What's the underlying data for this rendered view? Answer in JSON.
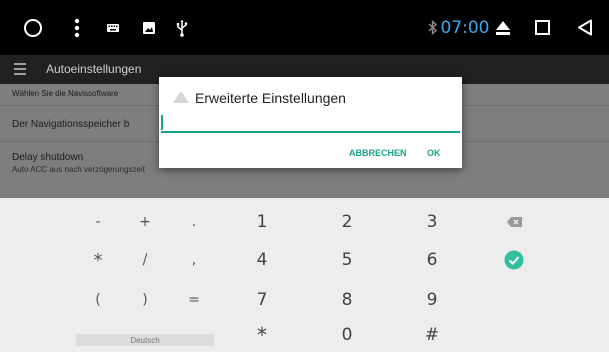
{
  "status_bar": {
    "time": "07:00",
    "icons": [
      "circle-icon",
      "more-vert-icon",
      "keyboard-icon",
      "image-icon",
      "usb-icon",
      "bluetooth-icon",
      "eject-icon",
      "square-icon",
      "back-icon"
    ],
    "accent_color": "#3ea7ee"
  },
  "app_bar": {
    "title": "Autoeinstellungen",
    "menu_icon": "menu-icon"
  },
  "settings_list": {
    "items": [
      {
        "title": "Wählen Sie die Navissoftware",
        "subtitle": ""
      },
      {
        "title": "Der Navigationsspeicher b",
        "subtitle": ""
      },
      {
        "title": "Delay shutdown",
        "subtitle": "Auto ACC aus nach verzögerungszeit"
      }
    ]
  },
  "dialog": {
    "title": "Erweiterte Einstellungen",
    "input_value": "",
    "cancel_label": "ABBRECHEN",
    "ok_label": "OK",
    "accent_color": "#17a589"
  },
  "keyboard": {
    "symbols": [
      [
        "-",
        "+",
        "."
      ],
      [
        "*",
        "/",
        ","
      ],
      [
        "(",
        ")",
        "="
      ]
    ],
    "digits": [
      [
        "1",
        "2",
        "3"
      ],
      [
        "4",
        "5",
        "6"
      ],
      [
        "7",
        "8",
        "9"
      ],
      [
        "*",
        "0",
        "#"
      ]
    ],
    "language_label": "Deutsch",
    "action_icons": [
      "backspace-icon",
      "done-check-icon"
    ],
    "done_color": "#34bfa0"
  }
}
